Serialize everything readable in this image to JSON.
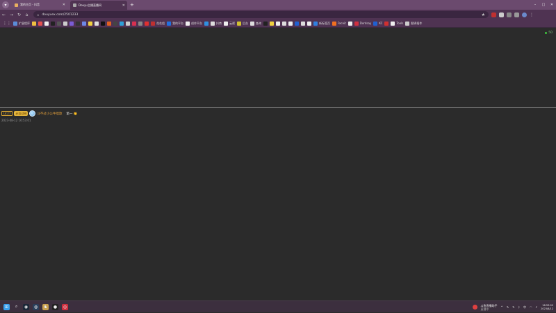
{
  "browser": {
    "tabs": [
      {
        "title": "我的主页 - 抖音",
        "active": false,
        "favicon_color": "#e9b060"
      },
      {
        "title": "Douyu主播直播间",
        "active": true,
        "favicon_color": "#aaa"
      }
    ],
    "newtab_label": "+",
    "address": "douyuex.com/2501233",
    "window_controls": [
      "–",
      "□",
      "✕"
    ],
    "bookmarks": [
      {
        "label": "扩展程序",
        "color": "#5b8dd8"
      },
      {
        "label": "",
        "color": "#f0c040"
      },
      {
        "label": "",
        "color": "#e35050"
      },
      {
        "label": "",
        "color": "#eee"
      },
      {
        "label": "",
        "color": "#222"
      },
      {
        "label": "",
        "color": "#555"
      },
      {
        "label": "",
        "color": "#ccc"
      },
      {
        "label": "",
        "color": "#7b5cd6"
      },
      {
        "label": "",
        "color": "#333"
      },
      {
        "label": "",
        "color": "#6e88e8"
      },
      {
        "label": "",
        "color": "#f0d040"
      },
      {
        "label": "",
        "color": "#ddd"
      },
      {
        "label": "",
        "color": "#111"
      },
      {
        "label": "",
        "color": "#e06020"
      },
      {
        "label": "",
        "color": "#444"
      },
      {
        "label": "",
        "color": "#2e9fd8"
      },
      {
        "label": "",
        "color": "#ccc"
      },
      {
        "label": "",
        "color": "#d83050"
      },
      {
        "label": "",
        "color": "#888"
      },
      {
        "label": "",
        "color": "#e03030"
      },
      {
        "label": "花花组",
        "color": "#c03030"
      },
      {
        "label": "我的平台",
        "color": "#2070e0"
      },
      {
        "label": "创作平台",
        "color": "#eee"
      },
      {
        "label": "",
        "color": "#3090e0"
      },
      {
        "label": "抖商",
        "color": "#ddd"
      },
      {
        "label": "云视",
        "color": "#eee"
      },
      {
        "label": "后台",
        "color": "#d0c030"
      },
      {
        "label": "查询",
        "color": "#ddd"
      },
      {
        "label": "",
        "color": "#222"
      },
      {
        "label": "",
        "color": "#f0d040"
      },
      {
        "label": "",
        "color": "#eee"
      },
      {
        "label": "",
        "color": "#ddd"
      },
      {
        "label": "",
        "color": "#eee"
      },
      {
        "label": "",
        "color": "#2060d0"
      },
      {
        "label": "",
        "color": "#ddd"
      },
      {
        "label": "",
        "color": "#eee"
      },
      {
        "label": "新标签页",
        "color": "#3080e0"
      },
      {
        "label": "Faceit",
        "color": "#f07020"
      },
      {
        "label": "",
        "color": "#eee"
      },
      {
        "label": "Dordsay",
        "color": "#d03040"
      },
      {
        "label": "KC",
        "color": "#2060d0"
      },
      {
        "label": "",
        "color": "#d03030"
      },
      {
        "label": "Tools",
        "color": "#eee"
      },
      {
        "label": "翻译插件",
        "color": "#ccc"
      }
    ]
  },
  "page": {
    "online_count": "50",
    "chat": {
      "level": "LV.27",
      "fan_badge": "赤焰战神",
      "username": "斗不过小公牛唱歌",
      "message": "第一 👏",
      "time": "2023-08-12 16:53:01"
    }
  },
  "taskbar": {
    "apps": [
      {
        "name": "windows-start-icon",
        "color": "#3aa0f0",
        "glyph": "⊞"
      },
      {
        "name": "search-icon",
        "color": "transparent",
        "glyph": "⌕"
      },
      {
        "name": "steam-icon",
        "color": "#1b2838",
        "glyph": "◉"
      },
      {
        "name": "steam2-icon",
        "color": "#2a3f5a",
        "glyph": "◍"
      },
      {
        "name": "game-icon",
        "color": "#c8a050",
        "glyph": "♞"
      },
      {
        "name": "obs-icon",
        "color": "#222",
        "glyph": "●"
      },
      {
        "name": "chrome-icon",
        "color": "#d03040",
        "glyph": "◎"
      }
    ],
    "tray_app_title": "斗鱼直播助手",
    "tray_app_subtitle": "直播中",
    "clock_time": "16:53:02",
    "clock_date": "2023/8/12"
  }
}
